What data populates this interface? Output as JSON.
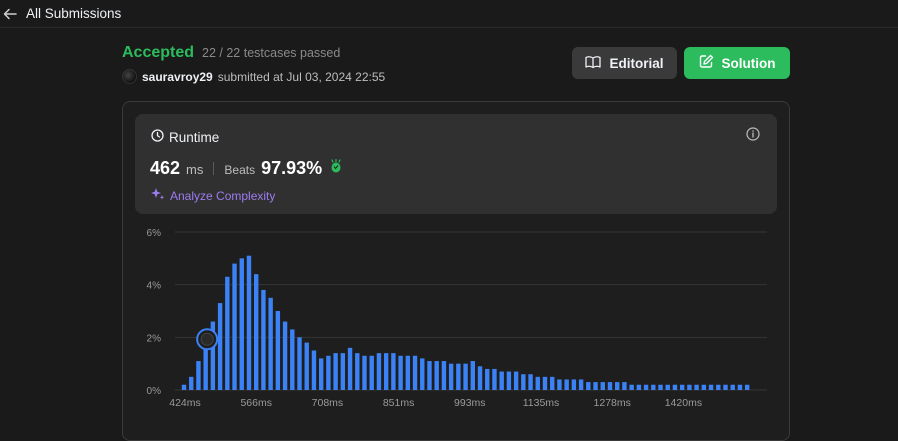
{
  "topbar": {
    "back_label": "All Submissions"
  },
  "result": {
    "status": "Accepted",
    "testcases": "22 / 22 testcases passed",
    "username": "sauravroy29",
    "submitted_text": "submitted at Jul 03, 2024 22:55"
  },
  "buttons": {
    "editorial": "Editorial",
    "solution": "Solution"
  },
  "runtime": {
    "title": "Runtime",
    "value": "462",
    "unit": "ms",
    "beats_label": "Beats",
    "beats_value": "97.93%",
    "analyze": "Analyze Complexity"
  },
  "colors": {
    "accent": "#2cbb5d",
    "bar": "#3b82f6",
    "analyze": "#9e7cf0"
  },
  "chart_data": {
    "type": "bar",
    "x_labels": [
      "424ms",
      "566ms",
      "708ms",
      "851ms",
      "993ms",
      "1135ms",
      "1278ms",
      "1420ms"
    ],
    "y_ticks": [
      "0%",
      "2%",
      "4%",
      "6%"
    ],
    "ylim": [
      0,
      6
    ],
    "values": [
      0.2,
      0.5,
      1.1,
      1.7,
      2.6,
      3.3,
      4.3,
      4.8,
      5.0,
      5.1,
      4.4,
      3.8,
      3.5,
      3.0,
      2.6,
      2.3,
      2.0,
      1.8,
      1.5,
      1.2,
      1.3,
      1.4,
      1.4,
      1.6,
      1.4,
      1.3,
      1.3,
      1.4,
      1.4,
      1.4,
      1.3,
      1.3,
      1.3,
      1.2,
      1.1,
      1.1,
      1.1,
      1.0,
      1.0,
      1.0,
      1.1,
      0.9,
      0.8,
      0.8,
      0.7,
      0.7,
      0.7,
      0.6,
      0.6,
      0.5,
      0.5,
      0.5,
      0.4,
      0.4,
      0.4,
      0.4,
      0.3,
      0.3,
      0.3,
      0.3,
      0.3,
      0.3,
      0.2,
      0.2,
      0.2,
      0.2,
      0.2,
      0.2,
      0.2,
      0.2,
      0.2,
      0.2,
      0.2,
      0.2,
      0.2,
      0.2,
      0.2,
      0.2,
      0.2
    ],
    "highlight_index": 3,
    "grid": true
  }
}
